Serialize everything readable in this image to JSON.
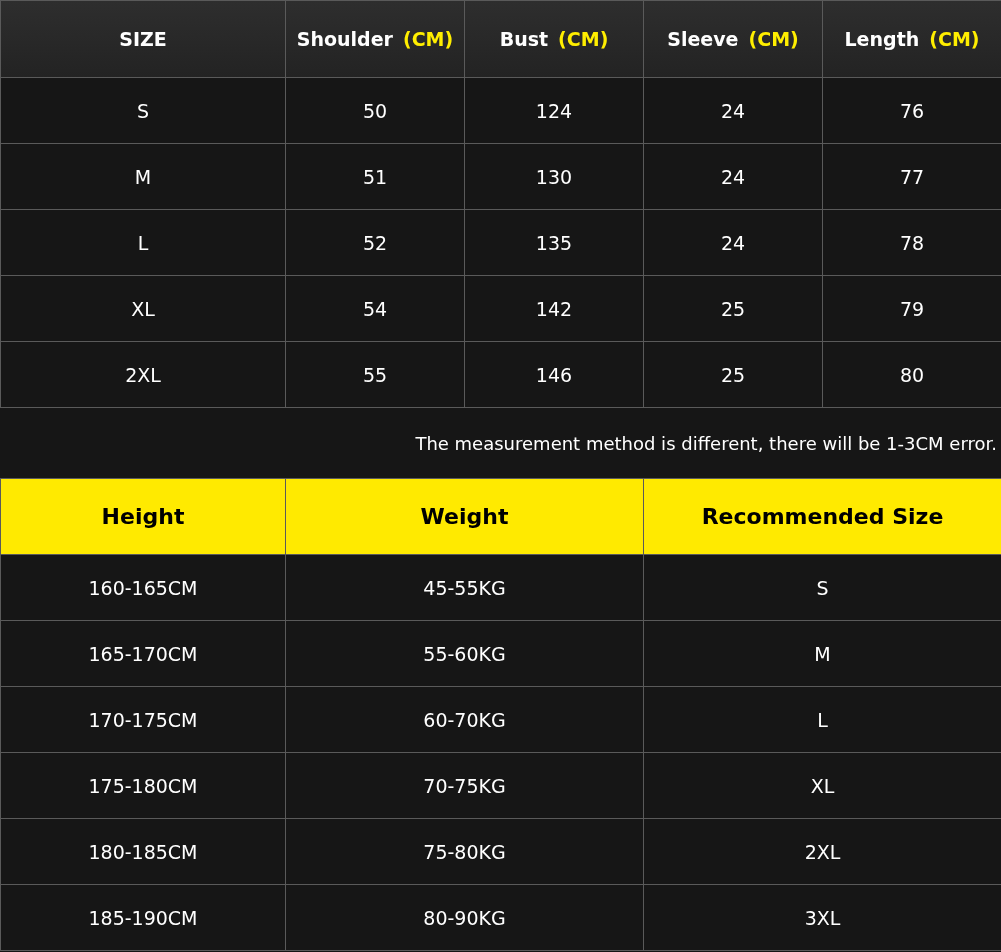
{
  "size_table": {
    "columns": [
      {
        "label": "SIZE"
      },
      {
        "label": "Shoulder",
        "unit": "(CM)"
      },
      {
        "label": "Bust",
        "unit": "(CM)"
      },
      {
        "label": "Sleeve",
        "unit": "(CM)"
      },
      {
        "label": "Length",
        "unit": "(CM)"
      }
    ],
    "rows": [
      [
        "S",
        "50",
        "124",
        "24",
        "76"
      ],
      [
        "M",
        "51",
        "130",
        "24",
        "77"
      ],
      [
        "L",
        "52",
        "135",
        "24",
        "78"
      ],
      [
        "XL",
        "54",
        "142",
        "25",
        "79"
      ],
      [
        "2XL",
        "55",
        "146",
        "25",
        "80"
      ]
    ]
  },
  "note": "The measurement method is different, there will be 1-3CM error.",
  "recommendation_table": {
    "columns": [
      "Height",
      "Weight",
      "Recommended Size"
    ],
    "rows": [
      [
        "160-165CM",
        "45-55KG",
        "S"
      ],
      [
        "165-170CM",
        "55-60KG",
        "M"
      ],
      [
        "170-175CM",
        "60-70KG",
        "L"
      ],
      [
        "175-180CM",
        "70-75KG",
        "XL"
      ],
      [
        "180-185CM",
        "75-80KG",
        "2XL"
      ],
      [
        "185-190CM",
        "80-90KG",
        "3XL"
      ]
    ]
  }
}
